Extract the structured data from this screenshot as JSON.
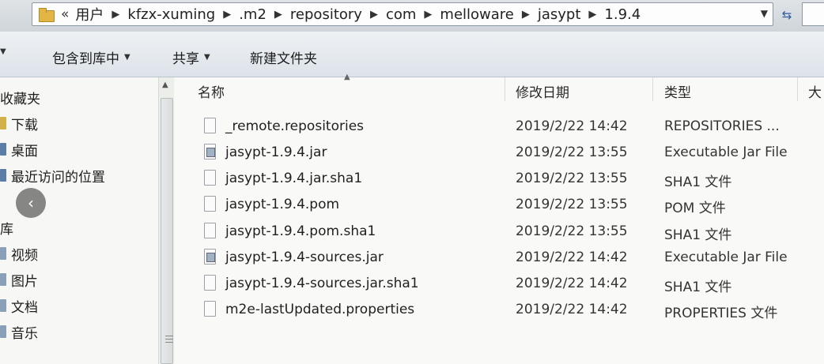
{
  "address_bar": {
    "overflow": "«",
    "crumbs": [
      "用户",
      "kfzx-xuming",
      ".m2",
      "repository",
      "com",
      "melloware",
      "jasypt",
      "1.9.4"
    ]
  },
  "toolbar": {
    "include_library": "包含到库中",
    "share": "共享",
    "new_folder": "新建文件夹"
  },
  "nav": {
    "favorites": "收藏夹",
    "downloads": "下载",
    "desktop": "桌面",
    "recent": "最近访问的位置",
    "libraries": "库",
    "videos": "视频",
    "pictures": "图片",
    "documents": "文档",
    "music": "音乐"
  },
  "columns": {
    "name": "名称",
    "date": "修改日期",
    "type": "类型",
    "size": "大"
  },
  "files": [
    {
      "name": "_remote.repositories",
      "date": "2019/2/22 14:42",
      "type": "REPOSITORIES ...",
      "icon": "file-icon"
    },
    {
      "name": "jasypt-1.9.4.jar",
      "date": "2019/2/22 13:55",
      "type": "Executable Jar File",
      "icon": "jar-file-icon"
    },
    {
      "name": "jasypt-1.9.4.jar.sha1",
      "date": "2019/2/22 13:55",
      "type": "SHA1 文件",
      "icon": "file-icon"
    },
    {
      "name": "jasypt-1.9.4.pom",
      "date": "2019/2/22 13:55",
      "type": "POM 文件",
      "icon": "file-icon"
    },
    {
      "name": "jasypt-1.9.4.pom.sha1",
      "date": "2019/2/22 13:55",
      "type": "SHA1 文件",
      "icon": "file-icon"
    },
    {
      "name": "jasypt-1.9.4-sources.jar",
      "date": "2019/2/22 14:42",
      "type": "Executable Jar File",
      "icon": "jar-file-icon"
    },
    {
      "name": "jasypt-1.9.4-sources.jar.sha1",
      "date": "2019/2/22 14:42",
      "type": "SHA1 文件",
      "icon": "file-icon"
    },
    {
      "name": "m2e-lastUpdated.properties",
      "date": "2019/2/22 14:42",
      "type": "PROPERTIES 文件",
      "icon": "file-icon"
    }
  ]
}
